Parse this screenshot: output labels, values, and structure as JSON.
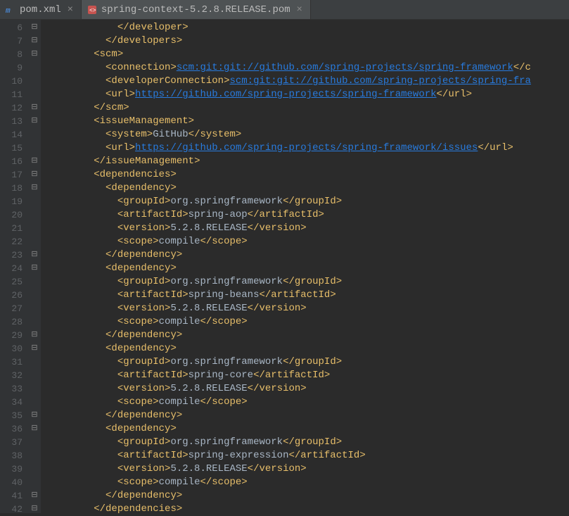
{
  "tabs": [
    {
      "label": "pom.xml",
      "active": false
    },
    {
      "label": "spring-context-5.2.8.RELEASE.pom",
      "active": true
    }
  ],
  "lineStart": 6,
  "lineEnd": 42,
  "code": {
    "l6": {
      "indent": 6,
      "closeTag": "developer"
    },
    "l7": {
      "indent": 5,
      "closeTag": "developers"
    },
    "l8": {
      "indent": 4,
      "openTag": "scm"
    },
    "l9": {
      "indent": 5,
      "tag": "connection",
      "content": "scm:git:git://github.com/spring-projects/spring-framework",
      "link": true,
      "closeVisible": "</c"
    },
    "l10": {
      "indent": 5,
      "tag": "developerConnection",
      "content": "scm:git:git://github.com/spring-projects/spring-fra",
      "link": true
    },
    "l11": {
      "indent": 5,
      "tag": "url",
      "content": "https://github.com/spring-projects/spring-framework",
      "link": true,
      "closeTag": "url"
    },
    "l12": {
      "indent": 4,
      "closeTag": "scm"
    },
    "l13": {
      "indent": 4,
      "openTag": "issueManagement"
    },
    "l14": {
      "indent": 5,
      "tag": "system",
      "content": "GitHub",
      "closeTag": "system"
    },
    "l15": {
      "indent": 5,
      "tag": "url",
      "content": "https://github.com/spring-projects/spring-framework/issues",
      "link": true,
      "closeTag": "url"
    },
    "l16": {
      "indent": 4,
      "closeTag": "issueManagement"
    },
    "l17": {
      "indent": 4,
      "openTag": "dependencies"
    },
    "l18": {
      "indent": 5,
      "openTag": "dependency"
    },
    "l19": {
      "indent": 6,
      "tag": "groupId",
      "content": "org.springframework",
      "closeTag": "groupId"
    },
    "l20": {
      "indent": 6,
      "tag": "artifactId",
      "content": "spring-aop",
      "closeTag": "artifactId"
    },
    "l21": {
      "indent": 6,
      "tag": "version",
      "content": "5.2.8.RELEASE",
      "closeTag": "version"
    },
    "l22": {
      "indent": 6,
      "tag": "scope",
      "content": "compile",
      "closeTag": "scope"
    },
    "l23": {
      "indent": 5,
      "closeTag": "dependency"
    },
    "l24": {
      "indent": 5,
      "openTag": "dependency"
    },
    "l25": {
      "indent": 6,
      "tag": "groupId",
      "content": "org.springframework",
      "closeTag": "groupId"
    },
    "l26": {
      "indent": 6,
      "tag": "artifactId",
      "content": "spring-beans",
      "closeTag": "artifactId"
    },
    "l27": {
      "indent": 6,
      "tag": "version",
      "content": "5.2.8.RELEASE",
      "closeTag": "version"
    },
    "l28": {
      "indent": 6,
      "tag": "scope",
      "content": "compile",
      "closeTag": "scope"
    },
    "l29": {
      "indent": 5,
      "closeTag": "dependency"
    },
    "l30": {
      "indent": 5,
      "openTag": "dependency"
    },
    "l31": {
      "indent": 6,
      "tag": "groupId",
      "content": "org.springframework",
      "closeTag": "groupId"
    },
    "l32": {
      "indent": 6,
      "tag": "artifactId",
      "content": "spring-core",
      "closeTag": "artifactId"
    },
    "l33": {
      "indent": 6,
      "tag": "version",
      "content": "5.2.8.RELEASE",
      "closeTag": "version"
    },
    "l34": {
      "indent": 6,
      "tag": "scope",
      "content": "compile",
      "closeTag": "scope"
    },
    "l35": {
      "indent": 5,
      "closeTag": "dependency"
    },
    "l36": {
      "indent": 5,
      "openTag": "dependency"
    },
    "l37": {
      "indent": 6,
      "tag": "groupId",
      "content": "org.springframework",
      "closeTag": "groupId"
    },
    "l38": {
      "indent": 6,
      "tag": "artifactId",
      "content": "spring-expression",
      "closeTag": "artifactId"
    },
    "l39": {
      "indent": 6,
      "tag": "version",
      "content": "5.2.8.RELEASE",
      "closeTag": "version"
    },
    "l40": {
      "indent": 6,
      "tag": "scope",
      "content": "compile",
      "closeTag": "scope"
    },
    "l41": {
      "indent": 5,
      "closeTag": "dependency"
    },
    "l42": {
      "indent": 4,
      "closeTag": "dependencies"
    }
  }
}
